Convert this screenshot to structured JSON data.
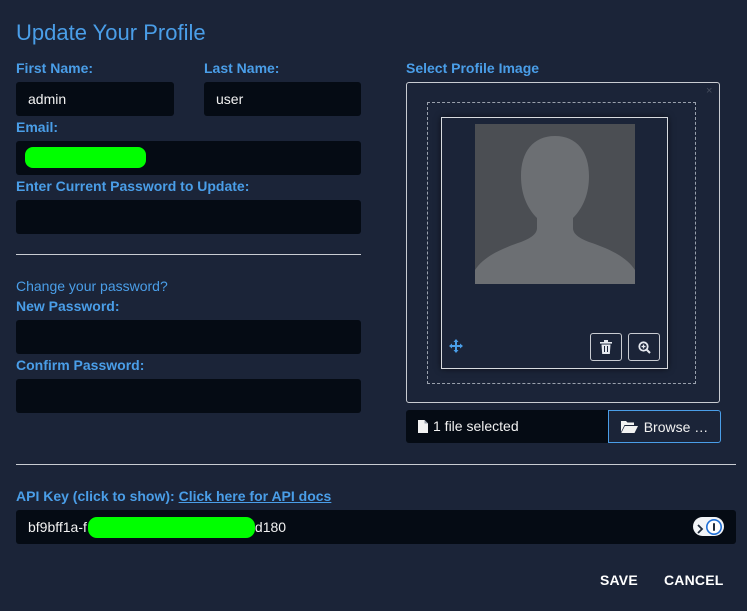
{
  "title": "Update Your Profile",
  "form": {
    "first_name_label": "First Name:",
    "first_name_value": "admin",
    "last_name_label": "Last Name:",
    "last_name_value": "user",
    "email_label": "Email:",
    "current_password_label": "Enter Current Password to Update:",
    "change_password_link": "Change your password?",
    "new_password_label": "New Password:",
    "confirm_password_label": "Confirm Password:"
  },
  "image": {
    "label": "Select Profile Image",
    "file_caption": "1 file selected",
    "browse_label": "Browse …",
    "close_glyph": "×"
  },
  "api": {
    "label": "API Key (click to show):",
    "docs_link": "Click here for API docs",
    "key_prefix": "bf9bff1a-f",
    "key_suffix": "d180"
  },
  "actions": {
    "save_label": "SAVE",
    "cancel_label": "CANCEL"
  },
  "colors": {
    "background": "#1b2438",
    "accent": "#4a9ee8",
    "input_bg": "#050b14",
    "redaction": "#00ff00"
  },
  "icons": {
    "trash": "trash-icon",
    "zoom": "zoom-in-icon",
    "move": "move-icon",
    "file": "file-icon",
    "folder": "folder-open-icon",
    "password_manager": "password-manager-icon"
  }
}
